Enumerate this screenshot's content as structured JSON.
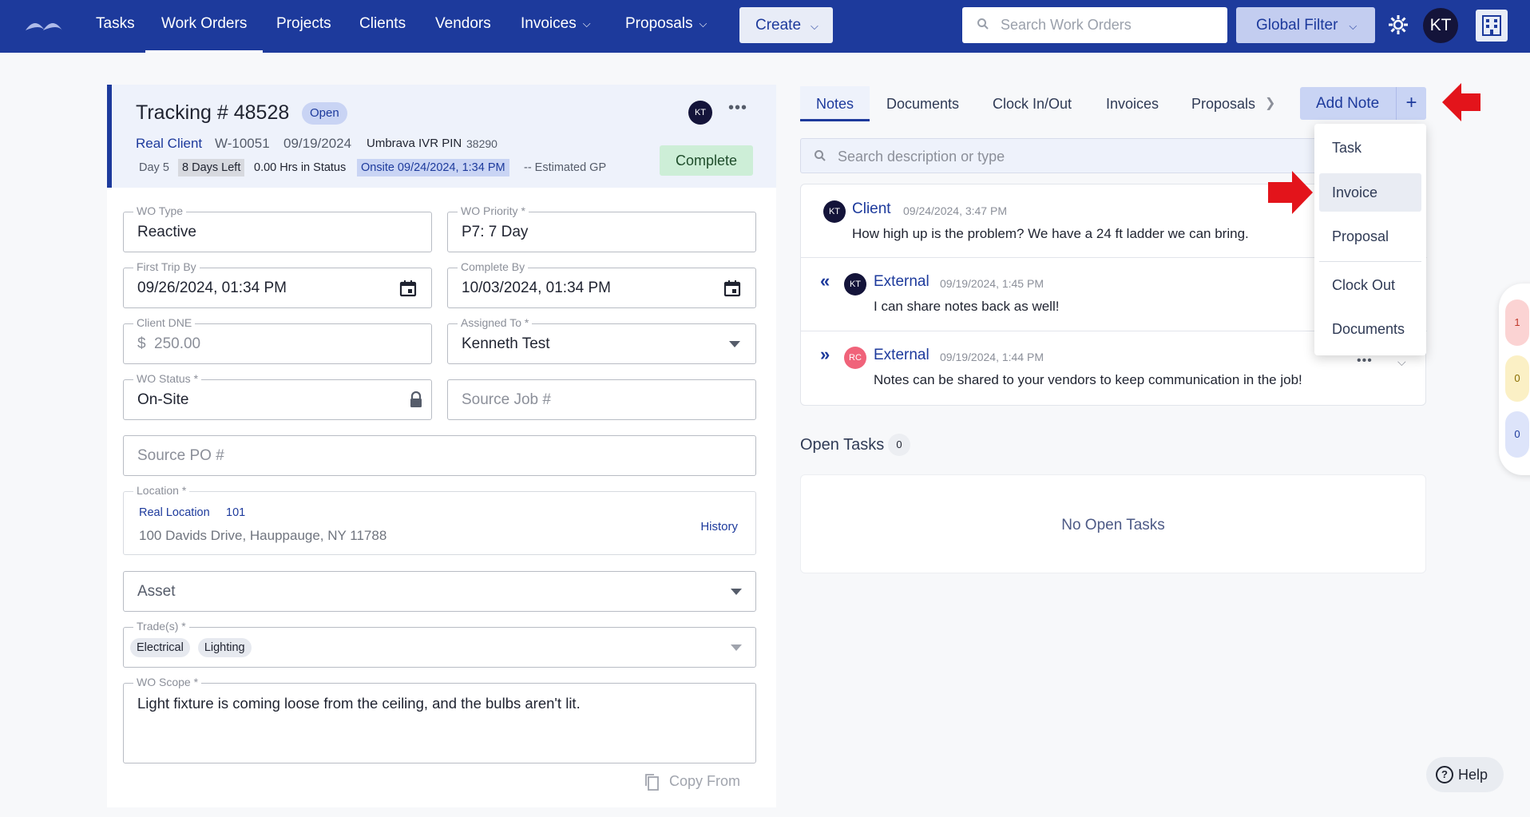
{
  "nav": {
    "tasks": "Tasks",
    "work_orders": "Work Orders",
    "projects": "Projects",
    "clients": "Clients",
    "vendors": "Vendors",
    "invoices": "Invoices",
    "proposals": "Proposals",
    "create": "Create",
    "search_placeholder": "Search Work Orders",
    "global_filter": "Global Filter",
    "avatar": "KT"
  },
  "header": {
    "title": "Tracking # 48528",
    "status": "Open",
    "avatar": "KT",
    "client": "Real Client",
    "wo_number": "W-10051",
    "date": "09/19/2024",
    "ivr_label": "Umbrava IVR PIN",
    "ivr_pin": "38290",
    "day": "Day 5",
    "days_left": "8 Days Left",
    "hrs_status": "0.00 Hrs in Status",
    "onsite": "Onsite 09/24/2024, 1:34 PM",
    "gp": "-- Estimated GP",
    "complete_button": "Complete"
  },
  "form": {
    "wo_type_label": "WO Type",
    "wo_type": "Reactive",
    "wo_priority_label": "WO Priority *",
    "wo_priority": "P7: 7 Day",
    "first_trip_label": "First Trip By",
    "first_trip": "09/26/2024, 01:34 PM",
    "complete_by_label": "Complete By",
    "complete_by": "10/03/2024, 01:34 PM",
    "client_dne_label": "Client DNE",
    "currency": "$",
    "client_dne": "250.00",
    "assigned_to_label": "Assigned To *",
    "assigned_to": "Kenneth Test",
    "wo_status_label": "WO Status *",
    "wo_status": "On-Site",
    "source_job_placeholder": "Source Job #",
    "source_po_placeholder": "Source PO #",
    "location_label": "Location *",
    "location_name": "Real Location",
    "location_number": "101",
    "location_address": "100 Davids Drive, Hauppauge, NY 11788",
    "history": "History",
    "asset_placeholder": "Asset",
    "trades_label": "Trade(s) *",
    "trades": [
      "Electrical",
      "Lighting"
    ],
    "scope_label": "WO Scope *",
    "scope": "Light fixture is coming loose from the ceiling, and the bulbs aren't lit.",
    "copy_from": "Copy From"
  },
  "tabs": {
    "notes": "Notes",
    "documents": "Documents",
    "clock": "Clock In/Out",
    "invoices": "Invoices",
    "proposals": "Proposals",
    "add_note": "Add Note"
  },
  "notes_search_placeholder": "Search description or type",
  "notes": [
    {
      "avatar": "KT",
      "author": "Client",
      "time": "09/24/2024, 3:47 PM",
      "text": "How high up is the problem? We have a 24 ft ladder we can bring."
    },
    {
      "avatar": "KT",
      "author": "External",
      "time": "09/19/2024, 1:45 PM",
      "text": "I can share notes back as well!"
    },
    {
      "avatar": "RC",
      "author": "External",
      "time": "09/19/2024, 1:44 PM",
      "text": "Notes can be shared to your vendors to keep communication in the job!"
    }
  ],
  "open_tasks": {
    "title": "Open Tasks",
    "count": "0",
    "empty": "No Open Tasks"
  },
  "menu": [
    "Task",
    "Invoice",
    "Proposal",
    "Clock Out",
    "Documents"
  ],
  "side_counts": [
    "1",
    "0",
    "0"
  ],
  "help": "Help",
  "colors": {
    "primary": "#1d3a9c",
    "accent_red": "#e3141b",
    "success_bg": "#cdeed7"
  }
}
